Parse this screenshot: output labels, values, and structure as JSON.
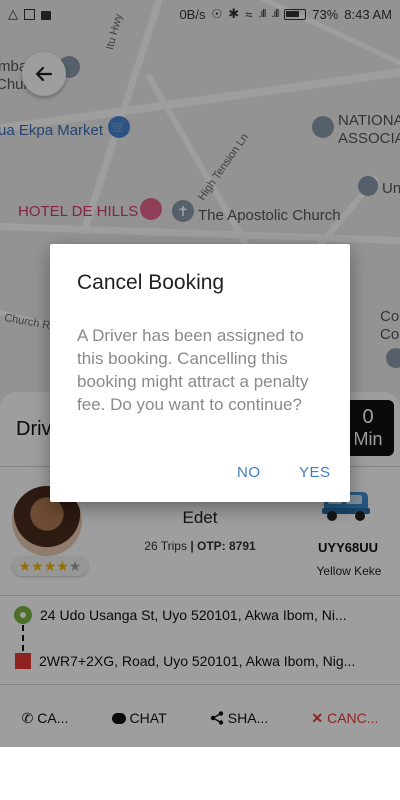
{
  "status_bar": {
    "net_speed": "0B/s",
    "battery": "73%",
    "time": "8:43 AM"
  },
  "map": {
    "labels": {
      "umba": "mba",
      "chur": "Chur",
      "itu_hwy": "Itu Hwy",
      "ekpa_market": "ua Ekpa Market",
      "national": "NATIONA",
      "associ": "ASSOCIA",
      "un": "Un",
      "high_tension": "High Tension Ln",
      "hotel": "HOTEL DE HILLS",
      "apostolic": "The Apostolic Church",
      "church_r": "Church R",
      "co1": "Co",
      "co2": "Co"
    }
  },
  "sheet": {
    "title_partial": "Driv",
    "eta": {
      "value": "0",
      "unit": "Min"
    },
    "driver": {
      "name": "Edet",
      "trips": "26 Trips",
      "otp": "| OTP: 8791",
      "rating_filled": 4,
      "rating_max": 5
    },
    "vehicle": {
      "plate": "UYY68UU",
      "type": "Yellow Keke"
    },
    "pickup": "24 Udo Usanga St, Uyo 520101, Akwa Ibom, Ni...",
    "dropoff": "2WR7+2XG, Road, Uyo 520101, Akwa Ibom, Nig...",
    "actions": {
      "call": "CA...",
      "chat": "CHAT",
      "share": "SHA...",
      "cancel": "CANC..."
    }
  },
  "dialog": {
    "title": "Cancel Booking",
    "message": "A Driver has been assigned to this booking. Cancelling this booking might attract a penalty fee. Do you want to continue?",
    "no_label": "NO",
    "yes_label": "YES"
  },
  "colors": {
    "accent_blue": "#3f7fc0",
    "cancel_red": "#e53935",
    "pickup_green": "#7cb342",
    "star_yellow": "#f5b400"
  }
}
